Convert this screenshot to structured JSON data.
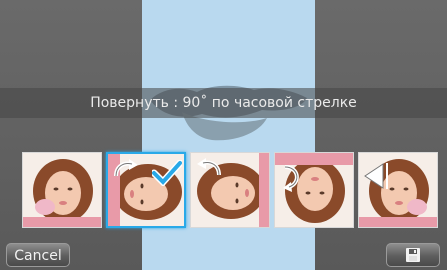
{
  "caption": "Повернуть : 90˚ по часовой стрелке",
  "buttons": {
    "cancel_label": "Cancel",
    "save_icon": "save-icon"
  },
  "thumbnails": [
    {
      "name": "thumb-original",
      "overlay_icon": "none",
      "selected": false
    },
    {
      "name": "thumb-rotate-right",
      "overlay_icon": "rotate-right-icon",
      "selected": true
    },
    {
      "name": "thumb-rotate-left",
      "overlay_icon": "rotate-left-icon",
      "selected": false
    },
    {
      "name": "thumb-rotate-180",
      "overlay_icon": "rotate-180-icon",
      "selected": false
    },
    {
      "name": "thumb-flip-horizontal",
      "overlay_icon": "flip-horizontal-icon",
      "selected": false
    }
  ],
  "colors": {
    "preview_bg": "#b9d9ef",
    "selection": "#29a9e8",
    "checkmark": "#29a9e8"
  }
}
